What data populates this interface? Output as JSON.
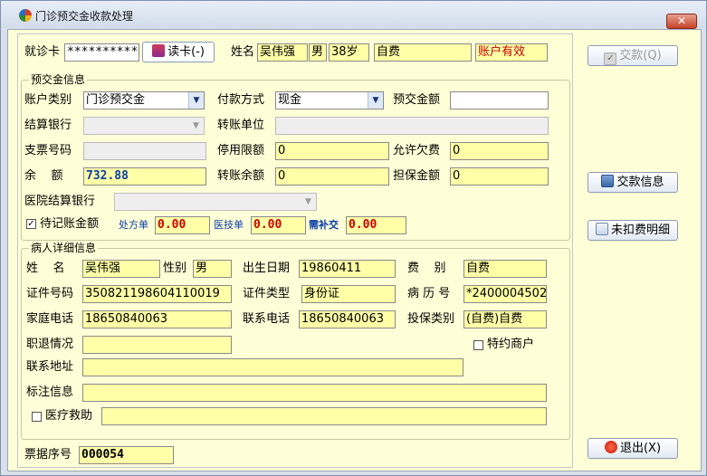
{
  "window": {
    "title": "门诊预交金收款处理",
    "close_label": "✕"
  },
  "card": {
    "label": "就诊卡",
    "value": "***********",
    "read_button": "读卡(-)"
  },
  "header": {
    "name_label": "姓名",
    "name": "吴伟强",
    "sex": "男",
    "age": "38岁",
    "pay_type": "自费",
    "account_status": "账户有效"
  },
  "prepay": {
    "group_title": "预交金信息",
    "account_type_label": "账户类别",
    "account_type": "门诊预交金",
    "pay_method_label": "付款方式",
    "pay_method": "现金",
    "amount_label": "预交金额",
    "amount": "",
    "bank_label": "结算银行",
    "bank": "",
    "transfer_unit_label": "转账单位",
    "transfer_unit": "",
    "check_no_label": "支票号码",
    "check_no": "",
    "stop_limit_label": "停用限额",
    "stop_limit": "0",
    "allow_owe_label": "允许欠费",
    "allow_owe": "0",
    "balance_label": "余    额",
    "balance": "732.88",
    "transfer_balance_label": "转账余额",
    "transfer_balance": "0",
    "guarantee_label": "担保金额",
    "guarantee": "0",
    "hospital_bank_label": "医院结算银行",
    "hospital_bank": "",
    "pending_label": "待记账金额",
    "pending_checked": true,
    "prescription_label": "处方单",
    "prescription": "0.00",
    "tech_label": "医技单",
    "tech": "0.00",
    "need_pay_label": "需补交",
    "need_pay": "0.00"
  },
  "patient": {
    "group_title": "病人详细信息",
    "name_label": "姓    名",
    "name": "吴伟强",
    "sex_label": "性别",
    "sex": "男",
    "birth_label": "出生日期",
    "birth": "19860411",
    "fee_label": "费    别",
    "fee": "自费",
    "id_label": "证件号码",
    "id": "350821198604110019",
    "id_type_label": "证件类型",
    "id_type": "身份证",
    "record_label": "病 历 号",
    "record": "*2400004502",
    "home_phone_label": "家庭电话",
    "home_phone": "18650840063",
    "contact_phone_label": "联系电话",
    "contact_phone": "18650840063",
    "insure_label": "投保类别",
    "insure": "(自费)自费",
    "retire_label": "职退情况",
    "retire": "",
    "merchant_label": "特约商户",
    "address_label": "联系地址",
    "address": "",
    "note_label": "标注信息",
    "note": "",
    "aid_label": "医疗救助",
    "aid": ""
  },
  "receipt": {
    "label": "票据序号",
    "value": "000054"
  },
  "side": {
    "pay_button": "交款(Q)",
    "pay_info_button": "交款信息",
    "unpaid_button": "未扣费明细",
    "exit_button": "退出(X)"
  }
}
